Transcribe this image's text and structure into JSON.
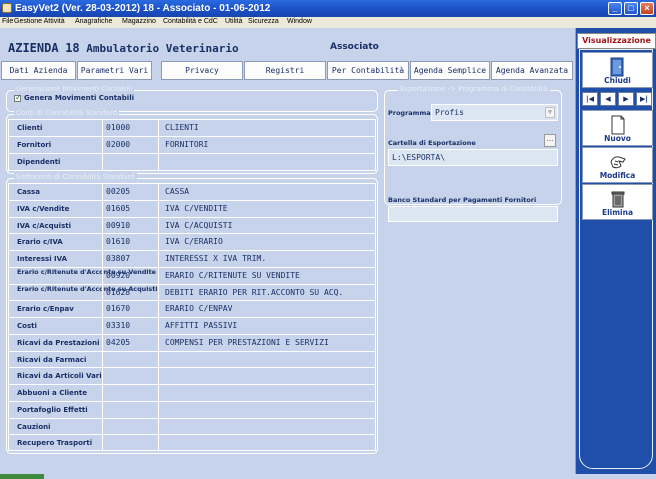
{
  "window": {
    "title": "EasyVet2 (Ver. 28-03-2012)   18 - Associato  -  01-06-2012",
    "minimize": "_",
    "maximize": "□",
    "close": "×"
  },
  "menu": [
    "File",
    "Gestione Attività",
    "Anagrafiche",
    "Magazzino",
    "Contabilità e CdC",
    "Utilità",
    "Sicurezza",
    "Window"
  ],
  "header": {
    "azienda_label": "AZIENDA",
    "azienda_num": "18",
    "azienda_name": "Ambulatorio Veterinario",
    "role": "Associato"
  },
  "tabs": [
    "Dati Azienda",
    "Parametri Vari",
    "Privacy",
    "Registri",
    "Per Contabilità",
    "Agenda Semplice",
    "Agenda Avanzata"
  ],
  "gen_movimenti": {
    "legend": "Generazione Movimenti Contabili",
    "checkbox_label": "Genera Movimenti Contabili",
    "checked": true
  },
  "conti": {
    "legend": "Conti di Contabilità Standard",
    "rows": [
      {
        "label": "Clienti",
        "code": "01000",
        "desc": "CLIENTI"
      },
      {
        "label": "Fornitori",
        "code": "02000",
        "desc": "FORNITORI"
      },
      {
        "label": "Dipendenti",
        "code": "",
        "desc": ""
      }
    ]
  },
  "sottoconti": {
    "legend": "Sottoconti di Contabilità Standard",
    "rows": [
      {
        "label": "Cassa",
        "code": "00205",
        "desc": "CASSA"
      },
      {
        "label": "IVA c/Vendite",
        "code": "01605",
        "desc": "IVA C/VENDITE"
      },
      {
        "label": "IVA c/Acquisti",
        "code": "00910",
        "desc": "IVA C/ACQUISTI"
      },
      {
        "label": "Erario c/IVA",
        "code": "01610",
        "desc": "IVA C/ERARIO"
      },
      {
        "label": "Interessi IVA",
        "code": "03807",
        "desc": "INTERESSI X IVA TRIM."
      },
      {
        "label": "Erario c/Ritenute d'Acconto su Vendite",
        "code": "00920",
        "desc": "ERARIO C/RITENUTE SU VENDITE"
      },
      {
        "label": "Erario c/Ritenute d'Acconto su Acquisti",
        "code": "01628",
        "desc": "DEBITI ERARIO PER RIT.ACCONTO SU ACQ."
      },
      {
        "label": "Erario c/Enpav",
        "code": "01670",
        "desc": "ERARIO C/ENPAV"
      },
      {
        "label": "Costi",
        "code": "03310",
        "desc": "AFFITTI PASSIVI"
      },
      {
        "label": "Ricavi da Prestazioni",
        "code": "04205",
        "desc": "COMPENSI PER PRESTAZIONI E SERVIZI"
      },
      {
        "label": "Ricavi da Farmaci",
        "code": "",
        "desc": ""
      },
      {
        "label": "Ricavi da Articoli Vari",
        "code": "",
        "desc": ""
      },
      {
        "label": "Abbuoni a Cliente",
        "code": "",
        "desc": ""
      },
      {
        "label": "Portafoglio Effetti",
        "code": "",
        "desc": ""
      },
      {
        "label": "Cauzioni",
        "code": "",
        "desc": ""
      },
      {
        "label": "Recupero Trasporti",
        "code": "",
        "desc": ""
      }
    ]
  },
  "esportazione": {
    "legend": "Esportazione -> Programma di Contabilità",
    "program_label": "Programma",
    "program_value": "Profis",
    "folder_label": "Cartella di Esportazione",
    "folder_value": "L:\\ESPORTA\\",
    "browse": "..."
  },
  "banco": {
    "label": "Banco Standard per Pagamenti Fornitori",
    "value": ""
  },
  "sidebar": {
    "tab": "Visualizzazione",
    "chiudi": "Chiudi",
    "nav": [
      "|◀",
      "◀",
      "▶",
      "▶|"
    ],
    "nuovo": "Nuovo",
    "modifica": "Modifica",
    "elimina": "Elimina"
  }
}
